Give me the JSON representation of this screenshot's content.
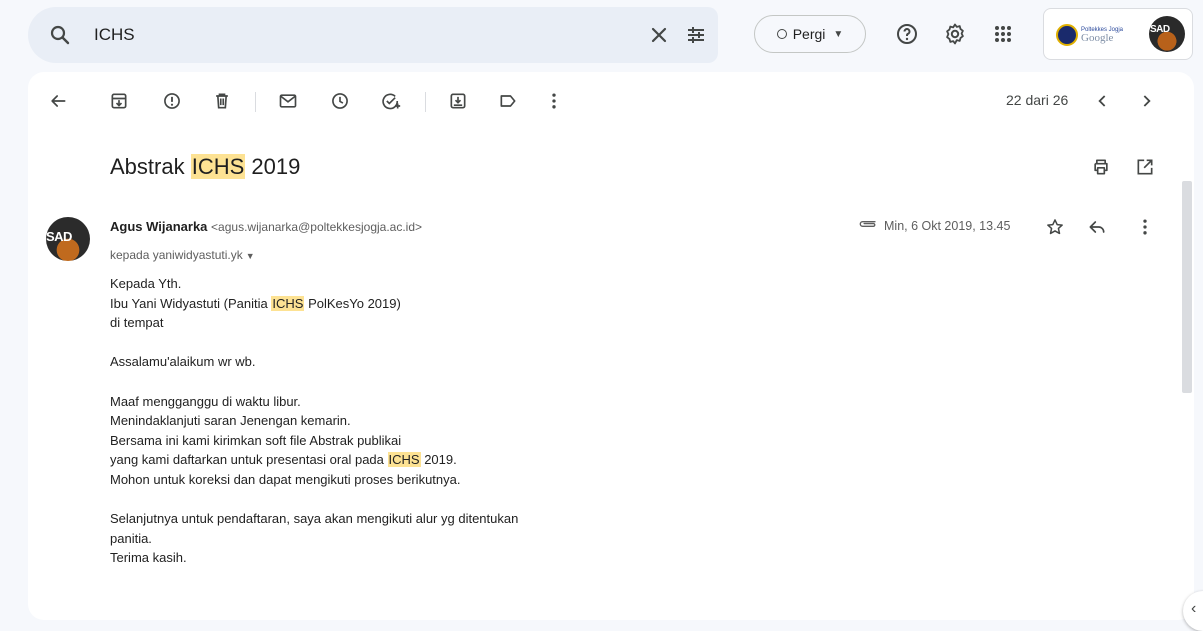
{
  "search": {
    "query": "ICHS",
    "search_icon": "search-icon",
    "clear_icon": "close-icon",
    "options_icon": "tune-icon"
  },
  "status": {
    "label": "Pergi"
  },
  "header_icons": [
    "help-icon",
    "settings-icon",
    "apps-icon"
  ],
  "account": {
    "org_logo_text_small": "Poltekkes Jogja",
    "org_logo_text": "Google",
    "avatar_text": "SAD"
  },
  "toolbar": {
    "icons": [
      "back-arrow-icon",
      "archive-icon",
      "report-spam-icon",
      "delete-icon",
      "mark-unread-icon",
      "snooze-icon",
      "add-to-tasks-icon",
      "move-to-icon",
      "label-icon",
      "more-vert-icon"
    ],
    "pager_text": "22 dari 26"
  },
  "email": {
    "subject_before": "Abstrak ",
    "subject_highlight": "ICHS",
    "subject_after": " 2019",
    "sender_name": "Agus Wijanarka",
    "sender_email": "<agus.wijanarka@poltekkesjogja.ac.id>",
    "to_line": "kepada yaniwidyastuti.yk",
    "date": "Min, 6 Okt 2019, 13.45",
    "avatar_text": "SAD",
    "body": {
      "l1": "Kepada Yth.",
      "l2a": "Ibu Yani Widyastuti (Panitia ",
      "l2h": "ICHS",
      "l2b": " PolKesYo 2019)",
      "l3": "di tempat",
      "l5": "Assalamu'alaikum wr wb.",
      "l7": "Maaf mengganggu di waktu libur.",
      "l8": "Menindaklanjuti saran Jenengan kemarin.",
      "l9": "Bersama ini kami kirimkan soft file Abstrak publikai",
      "l10a": "yang kami daftarkan untuk presentasi oral pada ",
      "l10h": "ICHS",
      "l10b": " 2019.",
      "l11": "Mohon untuk koreksi dan dapat mengikuti proses berikutnya.",
      "l13": "Selanjutnya untuk pendaftaran, saya akan mengikuti alur yg ditentukan",
      "l14": "panitia.",
      "l15": "Terima kasih."
    }
  },
  "colors": {
    "background": "#f6f8fc",
    "search_bg": "#e9eef6",
    "highlight": "#fde293",
    "icon": "#444746"
  }
}
